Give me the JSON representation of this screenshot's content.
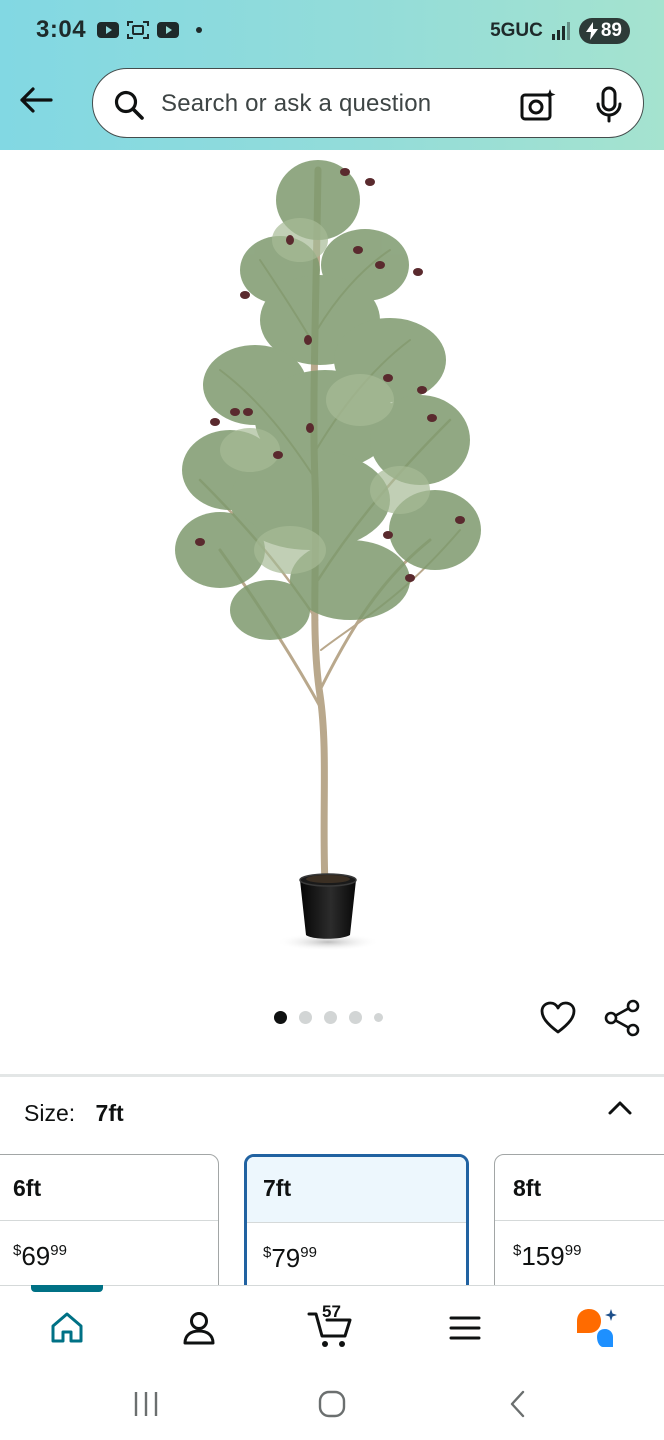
{
  "status_bar": {
    "time": "3:04",
    "network": "5GUC",
    "battery": "89",
    "left_icons": [
      "youtube-icon",
      "screenshot-icon",
      "youtube-icon"
    ]
  },
  "header": {
    "search_placeholder": "Search or ask a question",
    "back_icon": "back-arrow-icon",
    "camera_icon": "camera-search-icon",
    "mic_icon": "microphone-icon"
  },
  "product": {
    "image_alt": "olive-tree-in-black-pot",
    "carousel_dots": 5,
    "active_dot": 1
  },
  "size_selector": {
    "label": "Size:",
    "selected": "7ft",
    "options": [
      {
        "name": "6ft",
        "currency": "$",
        "whole": "69",
        "fraction": "99"
      },
      {
        "name": "7ft",
        "currency": "$",
        "whole": "79",
        "fraction": "99"
      },
      {
        "name": "8ft",
        "currency": "$",
        "whole": "159",
        "fraction": "99"
      }
    ]
  },
  "bottom_nav": {
    "items": [
      "home-icon",
      "account-icon",
      "cart-icon",
      "menu-icon",
      "rufus-icon"
    ],
    "active": "home-icon",
    "cart_count": "57"
  },
  "colors": {
    "header_gradient_start": "#82d8e3",
    "header_gradient_end": "#a5e3cf",
    "selected_border": "#2162a1",
    "nav_active": "#007185",
    "rufus_orange": "#ff6b00",
    "rufus_blue": "#1e90ff"
  }
}
